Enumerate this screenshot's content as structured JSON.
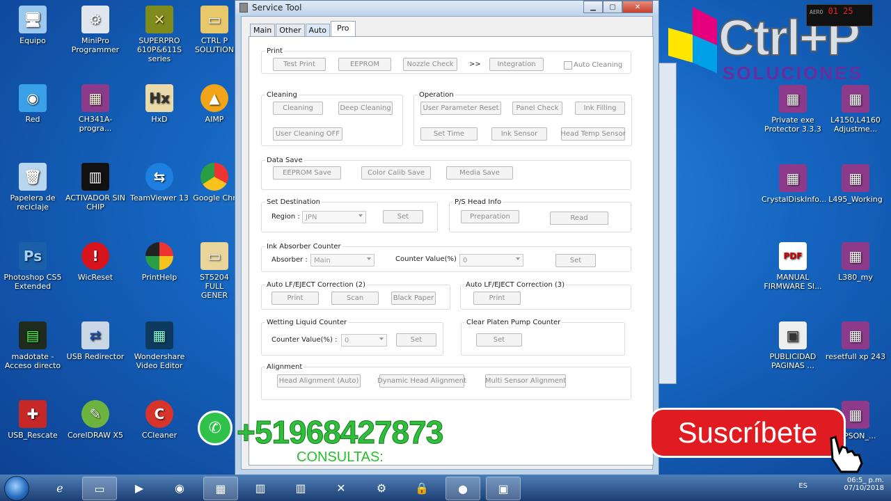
{
  "desktop_icons": [
    {
      "label": "Equipo",
      "icon": "computer-icon"
    },
    {
      "label": "MiniPro Programmer",
      "icon": "minipro-icon"
    },
    {
      "label": "SUPERPRO 610P&611S series",
      "icon": "superpro-icon"
    },
    {
      "label": "CTRL P SOLUTION",
      "icon": "folder-icon"
    },
    {
      "label": "Red",
      "icon": "network-icon"
    },
    {
      "label": "CH341A-progra...",
      "icon": "winrar-icon"
    },
    {
      "label": "HxD",
      "icon": "hxd-icon"
    },
    {
      "label": "AIMP",
      "icon": "aimp-icon"
    },
    {
      "label": "Papelera de reciclaje",
      "icon": "recycle-bin-icon"
    },
    {
      "label": "ACTIVADOR SIN CHIP",
      "icon": "chip-icon"
    },
    {
      "label": "TeamViewer 13",
      "icon": "teamviewer-icon"
    },
    {
      "label": "Google Chr",
      "icon": "chrome-icon"
    },
    {
      "label": "Photoshop CS5 Extended",
      "icon": "photoshop-icon"
    },
    {
      "label": "WicReset",
      "icon": "wicreset-icon"
    },
    {
      "label": "PrintHelp",
      "icon": "printhelp-icon"
    },
    {
      "label": "ST5204 FULL GENER",
      "icon": "folder-icon"
    },
    {
      "label": "madotate - Acceso directo",
      "icon": "shortcut-icon"
    },
    {
      "label": "USB Redirector",
      "icon": "usb-redirector-icon"
    },
    {
      "label": "Wondershare Video Editor",
      "icon": "video-editor-icon"
    },
    {
      "label": "USB_Rescate",
      "icon": "usb-rescue-icon"
    },
    {
      "label": "CorelDRAW X5",
      "icon": "coreldraw-icon"
    },
    {
      "label": "CCleaner",
      "icon": "ccleaner-icon"
    },
    {
      "label": "Private exe Protector 3.3.3",
      "icon": "winrar-icon"
    },
    {
      "label": "L4150,L4160 Adjustme...",
      "icon": "winrar-icon"
    },
    {
      "label": "CrystalDiskInfo...",
      "icon": "winrar-icon"
    },
    {
      "label": "L495_Working",
      "icon": "winrar-icon"
    },
    {
      "label": "MANUAL FIRMWARE SI...",
      "icon": "pdf-icon"
    },
    {
      "label": "L380_my",
      "icon": "winrar-icon"
    },
    {
      "label": "PUBLICIDAD PAGINAS ...",
      "icon": "image-icon"
    },
    {
      "label": "resetfull xp 243",
      "icon": "winrar-icon"
    },
    {
      "label": "_EPSON_...",
      "icon": "winrar-icon"
    }
  ],
  "window": {
    "title": "Service Tool",
    "tabs": [
      "Main",
      "Other",
      "Auto",
      "Pro"
    ],
    "active_tab": "Pro",
    "print": {
      "label": "Print",
      "test_print": "Test Print",
      "eeprom": "EEPROM",
      "nozzle_check": "Nozzle Check",
      "arrow": ">>",
      "integration": "Integration",
      "auto_cleaning": "Auto Cleaning"
    },
    "cleaning": {
      "label": "Cleaning",
      "cleaning": "Cleaning",
      "deep_cleaning": "Deep Cleaning",
      "user_cleaning_off": "User Cleaning OFF"
    },
    "operation": {
      "label": "Operation",
      "user_param_reset": "User Parameter Reset",
      "panel_check": "Panel Check",
      "ink_filling": "Ink Filling",
      "set_time": "Set Time",
      "ink_sensor": "Ink Sensor",
      "head_temp_sensor": "Head Temp Sensor"
    },
    "data_save": {
      "label": "Data Save",
      "eeprom_save": "EEPROM Save",
      "color_calib_save": "Color Calib Save",
      "media_save": "Media Save"
    },
    "set_destination": {
      "label": "Set Destination",
      "region_label": "Region :",
      "region_value": "JPN",
      "set": "Set"
    },
    "ps_head_info": {
      "label": "P/S Head Info",
      "preparation": "Preparation",
      "read": "Read"
    },
    "ink_absorber": {
      "label": "Ink Absorber Counter",
      "absorber_label": "Absorber :",
      "absorber_value": "Main",
      "counter_label": "Counter Value(%) :",
      "counter_value": "0",
      "set": "Set"
    },
    "auto_lf2": {
      "label": "Auto LF/EJECT Correction (2)",
      "print": "Print",
      "scan": "Scan",
      "black_paper": "Black Paper"
    },
    "auto_lf3": {
      "label": "Auto LF/EJECT Correction (3)",
      "print": "Print"
    },
    "wetting": {
      "label": "Wetting Liquid Counter",
      "counter_label": "Counter Value(%) :",
      "counter_value": "0",
      "set": "Set"
    },
    "platen": {
      "label": "Clear Platen Pump Counter",
      "set": "Set"
    },
    "alignment": {
      "label": "Alignment",
      "head_auto": "Head Alignment (Auto)",
      "dynamic_head": "Dynamic Head Alignment",
      "multi_sensor": "Multi Sensor Alignment"
    }
  },
  "overlay": {
    "phone": "+51968427873",
    "consultas": "CONSULTAS:",
    "subscribe": "Suscríbete",
    "brand": "Ctrl+P",
    "brand_sub": "SOLUCIONES",
    "gadget_label": "AERO",
    "gadget_value": "01 25"
  },
  "taskbar": {
    "language": "ES",
    "time": "06:5_ p.m.",
    "date": "07/10/2018"
  },
  "colors": {
    "whatsapp_green": "#2fbf3a",
    "subscribe_red": "#e01b22",
    "desktop_blue": "#1565c0"
  }
}
